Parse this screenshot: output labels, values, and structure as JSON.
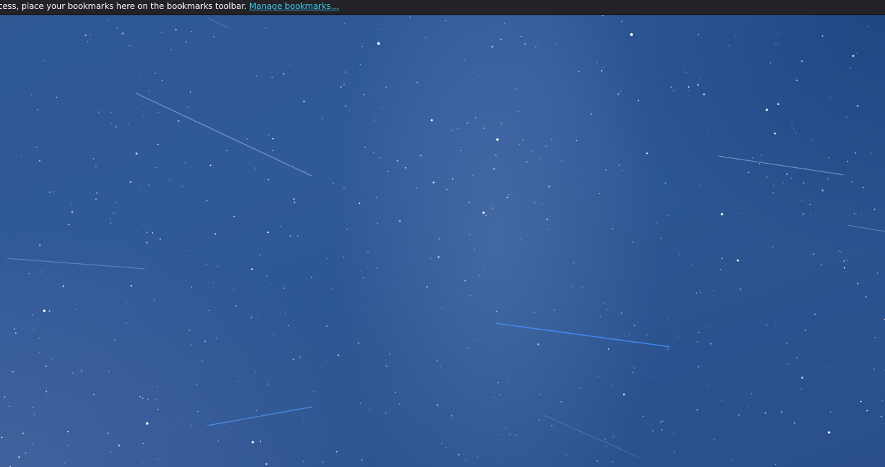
{
  "bookmarks_bar": {
    "message": "cess, place your bookmarks here on the bookmarks toolbar.",
    "link_label": "Manage bookmarks…"
  },
  "background": {
    "subject": "starry-night-sky",
    "colors": {
      "toolbar": "#232327",
      "link": "#3ec2e8",
      "sky": "#2f5895"
    }
  }
}
